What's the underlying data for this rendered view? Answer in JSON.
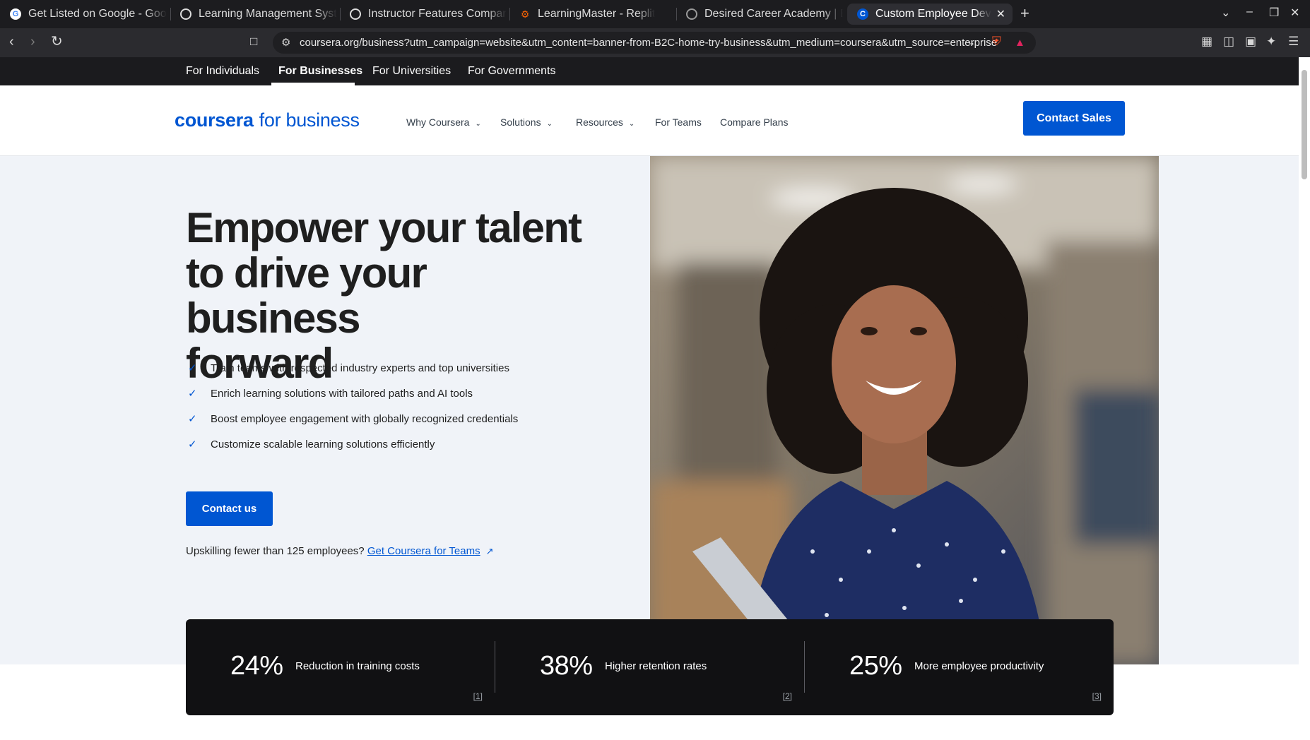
{
  "browser": {
    "tabs": [
      {
        "title": "Get Listed on Google - Goog",
        "favicon": "google-icon"
      },
      {
        "title": "Learning Management Syste",
        "favicon": "openai-icon"
      },
      {
        "title": "Instructor Features Compar",
        "favicon": "openai-icon"
      },
      {
        "title": "LearningMaster - Replit",
        "favicon": "replit-icon"
      },
      {
        "title": "Desired Career Academy | En",
        "favicon": "globe-icon"
      },
      {
        "title": "Custom Employee Devel",
        "favicon": "coursera-icon"
      }
    ],
    "active_tab_index": 5,
    "url": "coursera.org/business?utm_campaign=website&utm_content=banner-from-B2C-home-try-business&utm_medium=coursera&utm_source=enterprise"
  },
  "audience_nav": {
    "items": [
      "For Individuals",
      "For Businesses",
      "For Universities",
      "For Governments"
    ],
    "active": "For Businesses"
  },
  "header": {
    "logo_bold": "coursera",
    "logo_light": "for business",
    "nav": [
      {
        "label": "Why Coursera",
        "dropdown": true
      },
      {
        "label": "Solutions",
        "dropdown": true
      },
      {
        "label": "Resources",
        "dropdown": true
      },
      {
        "label": "For Teams",
        "dropdown": false
      },
      {
        "label": "Compare Plans",
        "dropdown": false
      }
    ],
    "cta": "Contact Sales"
  },
  "hero": {
    "title_lines": [
      "Empower your talent",
      "to drive your business",
      "forward"
    ],
    "bullets": [
      "Train teams with respected industry experts and top universities",
      "Enrich learning solutions with tailored paths and AI tools",
      "Boost employee engagement with globally recognized credentials",
      "Customize scalable learning solutions efficiently"
    ],
    "cta": "Contact us",
    "teams_prefix": "Upskilling fewer than 125 employees?",
    "teams_link": "Get Coursera for Teams"
  },
  "stats": [
    {
      "value": "24%",
      "label": "Reduction in training costs",
      "ref": "[1]"
    },
    {
      "value": "38%",
      "label": "Higher retention rates",
      "ref": "[2]"
    },
    {
      "value": "25%",
      "label": "More employee productivity",
      "ref": "[3]"
    }
  ],
  "colors": {
    "brand": "#0056d2",
    "hero_bg": "#f0f3f8",
    "stats_bg": "#111113",
    "top_nav_bg": "#1b1b1e"
  }
}
